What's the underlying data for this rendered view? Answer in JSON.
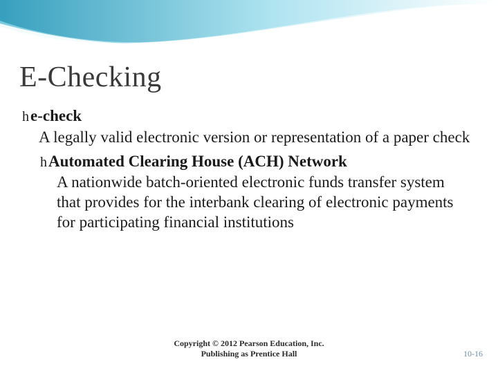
{
  "slide": {
    "title": "E-Checking",
    "bullets": [
      {
        "level": 1,
        "term": "e-check",
        "desc": "A legally valid electronic version or representation of a paper check"
      },
      {
        "level": 2,
        "term": "Automated Clearing House (ACH) Network",
        "desc": "A nationwide batch-oriented electronic funds transfer system that provides for the interbank clearing of electronic payments for participating financial institutions"
      }
    ],
    "footer_line1": "Copyright © 2012 Pearson Education, Inc.",
    "footer_line2": "Publishing as Prentice Hall",
    "page_number": "10-16",
    "bullet_glyph": "h"
  },
  "colors": {
    "wave_dark": "#1e7a9c",
    "wave_light": "#7fd0e4",
    "page_num": "#6d8fa3"
  }
}
